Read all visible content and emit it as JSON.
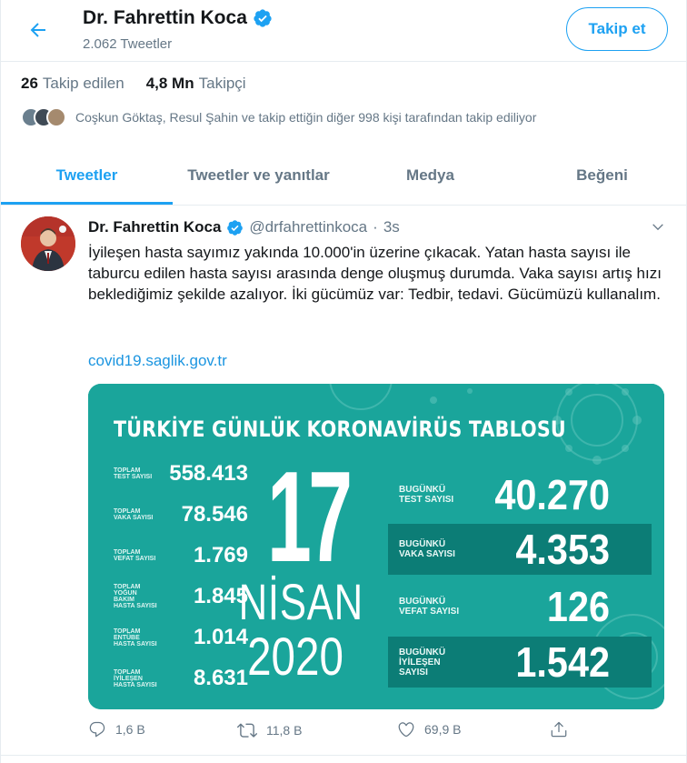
{
  "header": {
    "name": "Dr. Fahrettin Koca",
    "tweet_count": "2.062 Tweetler",
    "follow_label": "Takip et"
  },
  "stats": {
    "following_count": "26",
    "following_label": "Takip edilen",
    "followers_count": "4,8 Mn",
    "followers_label": "Takipçi",
    "followed_by_text": "Coşkun Göktaş, Resul Şahin ve takip ettiğin diğer 998 kişi tarafından takip ediliyor"
  },
  "tabs": [
    {
      "label": "Tweetler",
      "active": true
    },
    {
      "label": "Tweetler ve yanıtlar",
      "active": false
    },
    {
      "label": "Medya",
      "active": false
    },
    {
      "label": "Beğeni",
      "active": false
    }
  ],
  "tweet": {
    "name": "Dr. Fahrettin Koca",
    "handle": "@drfahrettinkoca",
    "separator": "·",
    "time": "3s",
    "text": "İyileşen hasta sayımız yakında 10.000'in üzerine çıkacak. Yatan hasta sayısı ile taburcu edilen hasta sayısı arasında denge oluşmuş durumda. Vaka sayısı artış hızı beklediğimiz şekilde azalıyor. İki gücümüz var: Tedbir, tedavi. Gücümüzü kullanalım.",
    "link": "covid19.saglik.gov.tr"
  },
  "card": {
    "title": "TÜRKİYE GÜNLÜK KORONAVİRÜS TABLOSU",
    "totals": [
      {
        "label": "TOPLAM TEST SAYISI",
        "value": "558.413"
      },
      {
        "label": "TOPLAM VAKA SAYISI",
        "value": "78.546"
      },
      {
        "label": "TOPLAM VEFAT SAYISI",
        "value": "1.769"
      },
      {
        "label": "TOPLAM YOĞUN BAKIM HASTA SAYISI",
        "value": "1.845"
      },
      {
        "label": "TOPLAM ENTÜBE HASTA SAYISI",
        "value": "1.014"
      },
      {
        "label": "TOPLAM İYİLEŞEN HASTA SAYISI",
        "value": "8.631"
      }
    ],
    "date_day": "17",
    "date_month": "NİSAN",
    "date_year": "2020",
    "today": [
      {
        "label": "BUGÜNKÜ TEST SAYISI",
        "value": "40.270"
      },
      {
        "label": "BUGÜNKÜ VAKA SAYISI",
        "value": "4.353"
      },
      {
        "label": "BUGÜNKÜ VEFAT SAYISI",
        "value": "126"
      },
      {
        "label": "BUGÜNKÜ İYİLEŞEN SAYISI",
        "value": "1.542"
      }
    ],
    "background_color": "#1aa59b",
    "highlight_color": "#0c7d76"
  },
  "actions": {
    "reply_count": "1,6 B",
    "retweet_count": "11,8 B",
    "like_count": "69,9 B"
  },
  "colors": {
    "accent": "#1da1f2",
    "muted": "#657786",
    "link": "#1b95e0",
    "verified": "#1da1f2"
  }
}
